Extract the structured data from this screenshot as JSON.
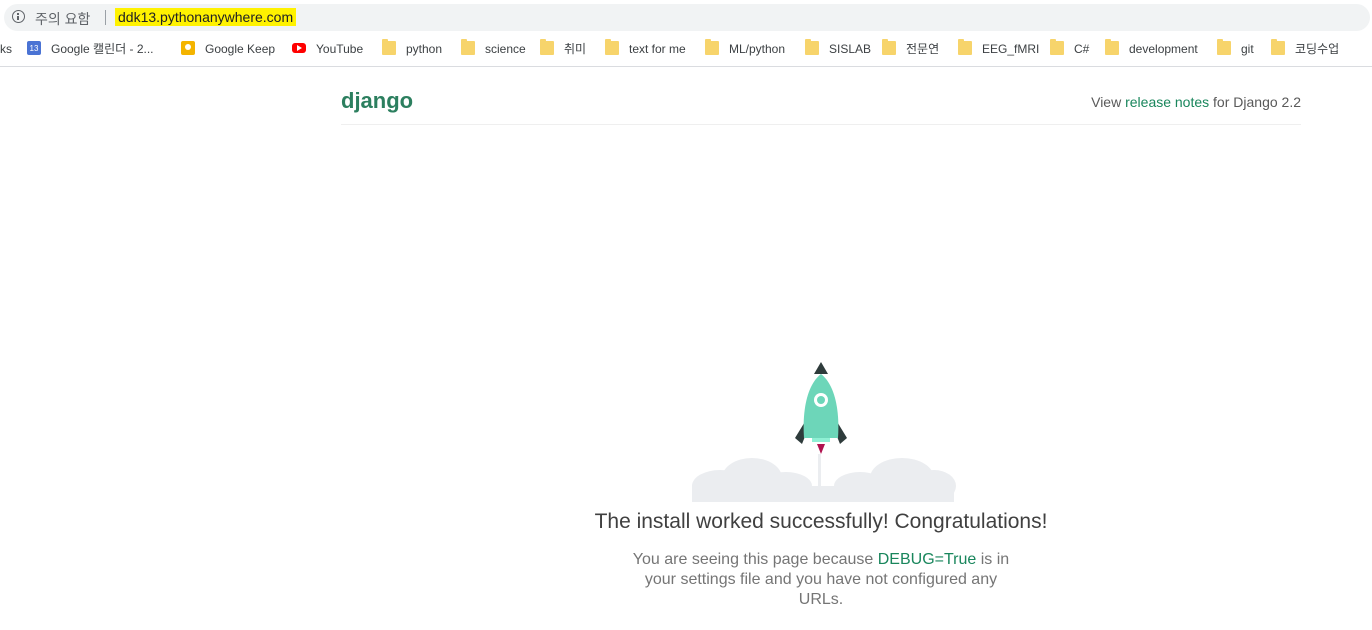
{
  "addressbar": {
    "security_label": "주의 요함",
    "url": "ddk13.pythonanywhere.com"
  },
  "bookmarks": [
    {
      "label": "ks",
      "icon": "apps-icon"
    },
    {
      "label": "Google 캘린더 - 2...",
      "icon": "calendar-icon"
    },
    {
      "label": "Google Keep",
      "icon": "keep-icon"
    },
    {
      "label": "YouTube",
      "icon": "youtube-icon"
    },
    {
      "label": "python",
      "icon": "folder-icon"
    },
    {
      "label": "science",
      "icon": "folder-icon"
    },
    {
      "label": "취미",
      "icon": "folder-icon"
    },
    {
      "label": "text for me",
      "icon": "folder-icon"
    },
    {
      "label": "ML/python",
      "icon": "folder-icon"
    },
    {
      "label": "SISLAB",
      "icon": "folder-icon"
    },
    {
      "label": "전문연",
      "icon": "folder-icon"
    },
    {
      "label": "EEG_fMRI",
      "icon": "folder-icon"
    },
    {
      "label": "C#",
      "icon": "folder-icon"
    },
    {
      "label": "development",
      "icon": "folder-icon"
    },
    {
      "label": "git",
      "icon": "folder-icon"
    },
    {
      "label": "코딩수업",
      "icon": "folder-icon"
    }
  ],
  "calendar_icon_text": "13",
  "header": {
    "logo": "django",
    "release_prefix": "View ",
    "release_link": "release notes",
    "release_suffix": " for Django 2.2"
  },
  "main": {
    "headline": "The install worked successfully! Congratulations!",
    "sub_before": "You are seeing this page because ",
    "sub_code": "DEBUG=True",
    "sub_after": " is in your settings file and you have not configured any URLs."
  },
  "colors": {
    "brand": "#0c4b33",
    "link": "#19865c",
    "rocket": "#6dd6b9",
    "url_highlight": "#fff200"
  }
}
